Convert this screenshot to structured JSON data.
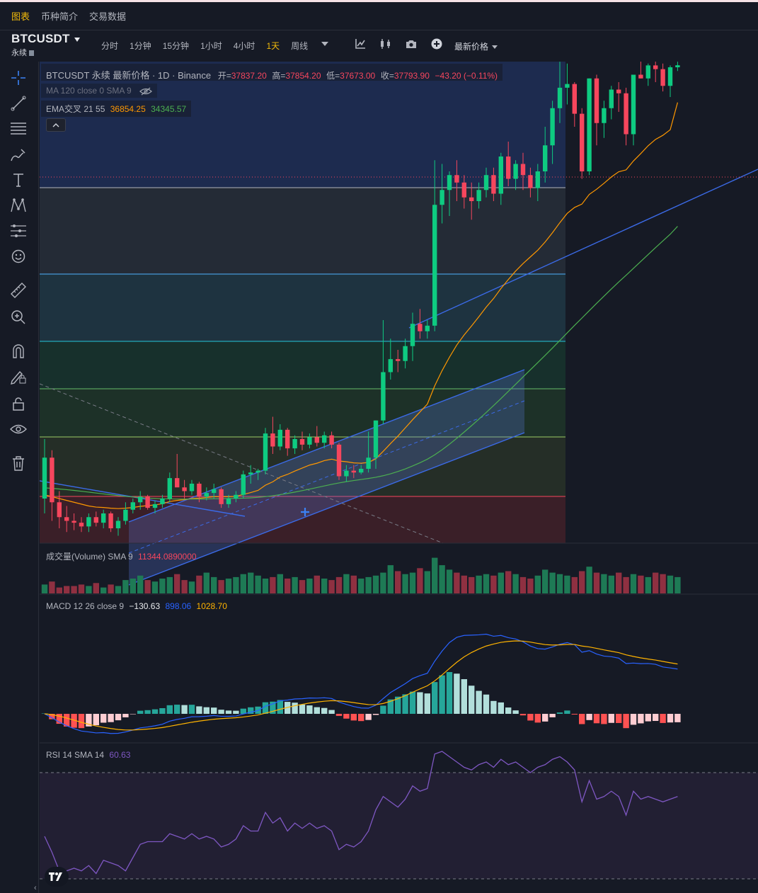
{
  "top_tabs": [
    "图表",
    "币种简介",
    "交易数据"
  ],
  "symbol": {
    "name": "BTCUSDT",
    "sub": "永续"
  },
  "intervals": [
    "分时",
    "1分钟",
    "15分钟",
    "1小时",
    "4小时",
    "1天",
    "周线"
  ],
  "active_interval": "1天",
  "toolbar_icons": [
    "chevron-down-icon",
    "indicators-icon",
    "chart-type-icon",
    "camera-icon",
    "add-icon"
  ],
  "price_source": "最新价格",
  "legend": {
    "title": "BTCUSDT 永续 最新价格 · 1D · Binance",
    "open_label": "开=",
    "open": "37837.20",
    "high_label": "高=",
    "high": "37854.20",
    "low_label": "低=",
    "low": "37673.00",
    "close_label": "收=",
    "close": "37793.90",
    "change": "−43.20 (−0.11%)",
    "ma": "MA 120 close 0 SMA 9",
    "ema_name": "EMA交叉 21 55",
    "ema_fast": "36854.25",
    "ema_slow": "34345.57"
  },
  "volume_legend": {
    "name": "成交量(Volume) SMA 9",
    "value": "11344.0890000"
  },
  "macd_legend": {
    "name": "MACD 12 26 close 9",
    "hist": "−130.63",
    "macd": "898.06",
    "signal": "1028.70"
  },
  "rsi_legend": {
    "name": "RSI 14 SMA 14",
    "value": "60.63"
  },
  "colors": {
    "up": "#0ecb81",
    "down": "#f6465d",
    "accent": "#f0b90b",
    "ema_fast": "#ff9800",
    "ema_slow": "#4caf50",
    "macd": "#2962ff",
    "signal": "#ffb300",
    "rsi": "#7e57c2"
  },
  "chart_data": [
    {
      "type": "candlestick",
      "title": "BTCUSDT 永续 最新价格 · 1D · Binance",
      "last_candle": {
        "open": 37837.2,
        "high": 37854.2,
        "low": 37673.0,
        "close": 37793.9
      },
      "ohlc": [
        [
          26200,
          27800,
          25800,
          27300
        ],
        [
          27300,
          27500,
          25600,
          26100
        ],
        [
          26100,
          26400,
          25400,
          25700
        ],
        [
          25700,
          26000,
          25300,
          25600
        ],
        [
          25600,
          25800,
          25350,
          25550
        ],
        [
          25550,
          25700,
          25300,
          25450
        ],
        [
          25450,
          25800,
          25300,
          25700
        ],
        [
          25700,
          25850,
          25450,
          25550
        ],
        [
          25550,
          25900,
          25400,
          25800
        ],
        [
          25800,
          25850,
          25300,
          25400
        ],
        [
          25400,
          25700,
          25200,
          25600
        ],
        [
          25600,
          26100,
          25500,
          25900
        ],
        [
          25900,
          26200,
          25800,
          26100
        ],
        [
          26100,
          26400,
          25900,
          26250
        ],
        [
          26250,
          26300,
          25900,
          25950
        ],
        [
          25950,
          26150,
          25800,
          26050
        ],
        [
          26050,
          26300,
          25950,
          26200
        ],
        [
          26200,
          26900,
          26100,
          26750
        ],
        [
          26750,
          27400,
          26600,
          26500
        ],
        [
          26500,
          26700,
          26200,
          26400
        ],
        [
          26400,
          26700,
          26300,
          26600
        ],
        [
          26600,
          26650,
          26100,
          26250
        ],
        [
          26250,
          26500,
          26150,
          26350
        ],
        [
          26350,
          26600,
          26200,
          26450
        ],
        [
          26450,
          26500,
          25950,
          26050
        ],
        [
          26050,
          26300,
          25950,
          26200
        ],
        [
          26200,
          26400,
          26100,
          26300
        ],
        [
          26300,
          26950,
          26200,
          26850
        ],
        [
          26850,
          27100,
          26600,
          26900
        ],
        [
          26900,
          27000,
          26700,
          26950
        ],
        [
          26950,
          28100,
          26850,
          27950
        ],
        [
          27950,
          28400,
          27400,
          27600
        ],
        [
          27600,
          28200,
          27500,
          28050
        ],
        [
          28050,
          28100,
          27350,
          27550
        ],
        [
          27550,
          27900,
          27400,
          27800
        ],
        [
          27800,
          28000,
          27500,
          27650
        ],
        [
          27650,
          27950,
          27550,
          27850
        ],
        [
          27850,
          28150,
          27600,
          27700
        ],
        [
          27700,
          28000,
          27550,
          27900
        ],
        [
          27900,
          28000,
          27550,
          27650
        ],
        [
          27650,
          27700,
          26700,
          26800
        ],
        [
          26800,
          27100,
          26650,
          26950
        ],
        [
          26950,
          27100,
          26750,
          26900
        ],
        [
          26900,
          27100,
          26850,
          27000
        ],
        [
          27000,
          28000,
          26900,
          27300
        ],
        [
          27300,
          28300,
          27000,
          28300
        ],
        [
          28300,
          31000,
          28200,
          29600
        ],
        [
          29600,
          30500,
          29400,
          29950
        ],
        [
          29950,
          30200,
          29600,
          29900
        ],
        [
          29900,
          30500,
          29700,
          30300
        ],
        [
          30300,
          31200,
          29900,
          30900
        ],
        [
          30900,
          31300,
          30500,
          30700
        ],
        [
          30700,
          31000,
          30500,
          30850
        ],
        [
          30850,
          35300,
          30700,
          34100
        ],
        [
          34100,
          35200,
          33600,
          34500
        ],
        [
          34500,
          35000,
          33800,
          34900
        ],
        [
          34900,
          35300,
          34200,
          34700
        ],
        [
          34700,
          34900,
          34000,
          34300
        ],
        [
          34300,
          34700,
          33700,
          34200
        ],
        [
          34200,
          34700,
          34000,
          34500
        ],
        [
          34500,
          35100,
          34300,
          34900
        ],
        [
          34900,
          35100,
          34200,
          34400
        ],
        [
          34400,
          35500,
          34100,
          35400
        ],
        [
          35400,
          35800,
          34600,
          34800
        ],
        [
          34800,
          35300,
          34500,
          35200
        ],
        [
          35200,
          35500,
          34500,
          34900
        ],
        [
          34900,
          35100,
          34300,
          34550
        ],
        [
          34550,
          35200,
          34200,
          35000
        ],
        [
          35000,
          36200,
          34700,
          35700
        ],
        [
          35700,
          36900,
          35200,
          36700
        ],
        [
          36700,
          37950,
          36300,
          37250
        ],
        [
          37250,
          37900,
          36800,
          37350
        ],
        [
          37350,
          37400,
          36200,
          36550
        ],
        [
          36550,
          36700,
          34800,
          35000
        ],
        [
          35000,
          37500,
          34900,
          37500
        ],
        [
          37500,
          37600,
          35700,
          36300
        ],
        [
          36300,
          36900,
          35900,
          36700
        ],
        [
          36700,
          37300,
          36400,
          37200
        ],
        [
          37200,
          37400,
          36600,
          37100
        ],
        [
          37100,
          37250,
          35700,
          36000
        ],
        [
          36000,
          37500,
          35700,
          37600
        ],
        [
          37600,
          38000,
          37500,
          37500
        ],
        [
          37500,
          37900,
          37300,
          37850
        ],
        [
          37850,
          38000,
          37400,
          37750
        ],
        [
          37750,
          37900,
          37150,
          37300
        ],
        [
          37300,
          37850,
          37000,
          37800
        ],
        [
          37800,
          37950,
          37700,
          37854
        ]
      ],
      "ema_fast": [
        26300,
        26250,
        26200,
        26150,
        26100,
        26050,
        26000,
        25970,
        25960,
        25940,
        25930,
        25940,
        25960,
        25990,
        26010,
        26030,
        26060,
        26120,
        26150,
        26170,
        26200,
        26210,
        26230,
        26250,
        26250,
        26250,
        26260,
        26310,
        26360,
        26420,
        26560,
        26650,
        26780,
        26850,
        26940,
        27020,
        27100,
        27150,
        27220,
        27260,
        27210,
        27190,
        27160,
        27150,
        27170,
        27270,
        27470,
        27680,
        27880,
        28100,
        28320,
        28530,
        28740,
        29230,
        29640,
        30000,
        30330,
        30600,
        30840,
        31090,
        31350,
        31580,
        31850,
        32090,
        32320,
        32520,
        32700,
        32880,
        33100,
        33350,
        33620,
        33870,
        34030,
        34120,
        34380,
        34520,
        34680,
        34850,
        34990,
        35040,
        35280,
        35480,
        35690,
        35860,
        35970,
        36120,
        36854
      ]
    },
    {
      "type": "bar",
      "title": "成交量(Volume) SMA 9",
      "values": [
        6,
        8,
        4,
        5,
        5,
        6,
        5,
        7,
        4,
        6,
        5,
        9,
        10,
        12,
        9,
        8,
        10,
        11,
        13,
        9,
        8,
        12,
        14,
        11,
        9,
        10,
        11,
        13,
        14,
        12,
        10,
        11,
        13,
        10,
        11,
        9,
        10,
        12,
        10,
        9,
        11,
        13,
        12,
        10,
        11,
        12,
        14,
        19,
        15,
        13,
        14,
        17,
        15,
        24,
        19,
        16,
        14,
        12,
        11,
        12,
        13,
        12,
        14,
        15,
        13,
        11,
        10,
        12,
        16,
        14,
        13,
        12,
        11,
        15,
        18,
        14,
        13,
        12,
        14,
        11,
        13,
        12,
        11,
        14,
        13,
        12,
        11
      ],
      "sma_value": 11344.089
    },
    {
      "type": "line",
      "title": "MACD 12 26 close 9",
      "hist_value": -130.63,
      "macd_value": 898.06,
      "signal_value": 1028.7
    },
    {
      "type": "line",
      "title": "RSI 14 SMA 14",
      "value": 60.63,
      "bands": [
        70,
        30
      ],
      "values": [
        46,
        40,
        33,
        33,
        34,
        33,
        35,
        32,
        37,
        36,
        35,
        33,
        38,
        43,
        44,
        44,
        44,
        47,
        46,
        45,
        47,
        45,
        46,
        45,
        42,
        43,
        45,
        50,
        48,
        48,
        55,
        51,
        53,
        48,
        51,
        49,
        51,
        49,
        50,
        48,
        41,
        43,
        42,
        44,
        48,
        56,
        61,
        59,
        57,
        60,
        65,
        63,
        64,
        77,
        78,
        76,
        74,
        72,
        71,
        73,
        74,
        72,
        75,
        73,
        74,
        72,
        70,
        72,
        73,
        75,
        76,
        74,
        71,
        59,
        67,
        60,
        61,
        63,
        61,
        54,
        63,
        60,
        61,
        60,
        59,
        60,
        61
      ]
    }
  ]
}
